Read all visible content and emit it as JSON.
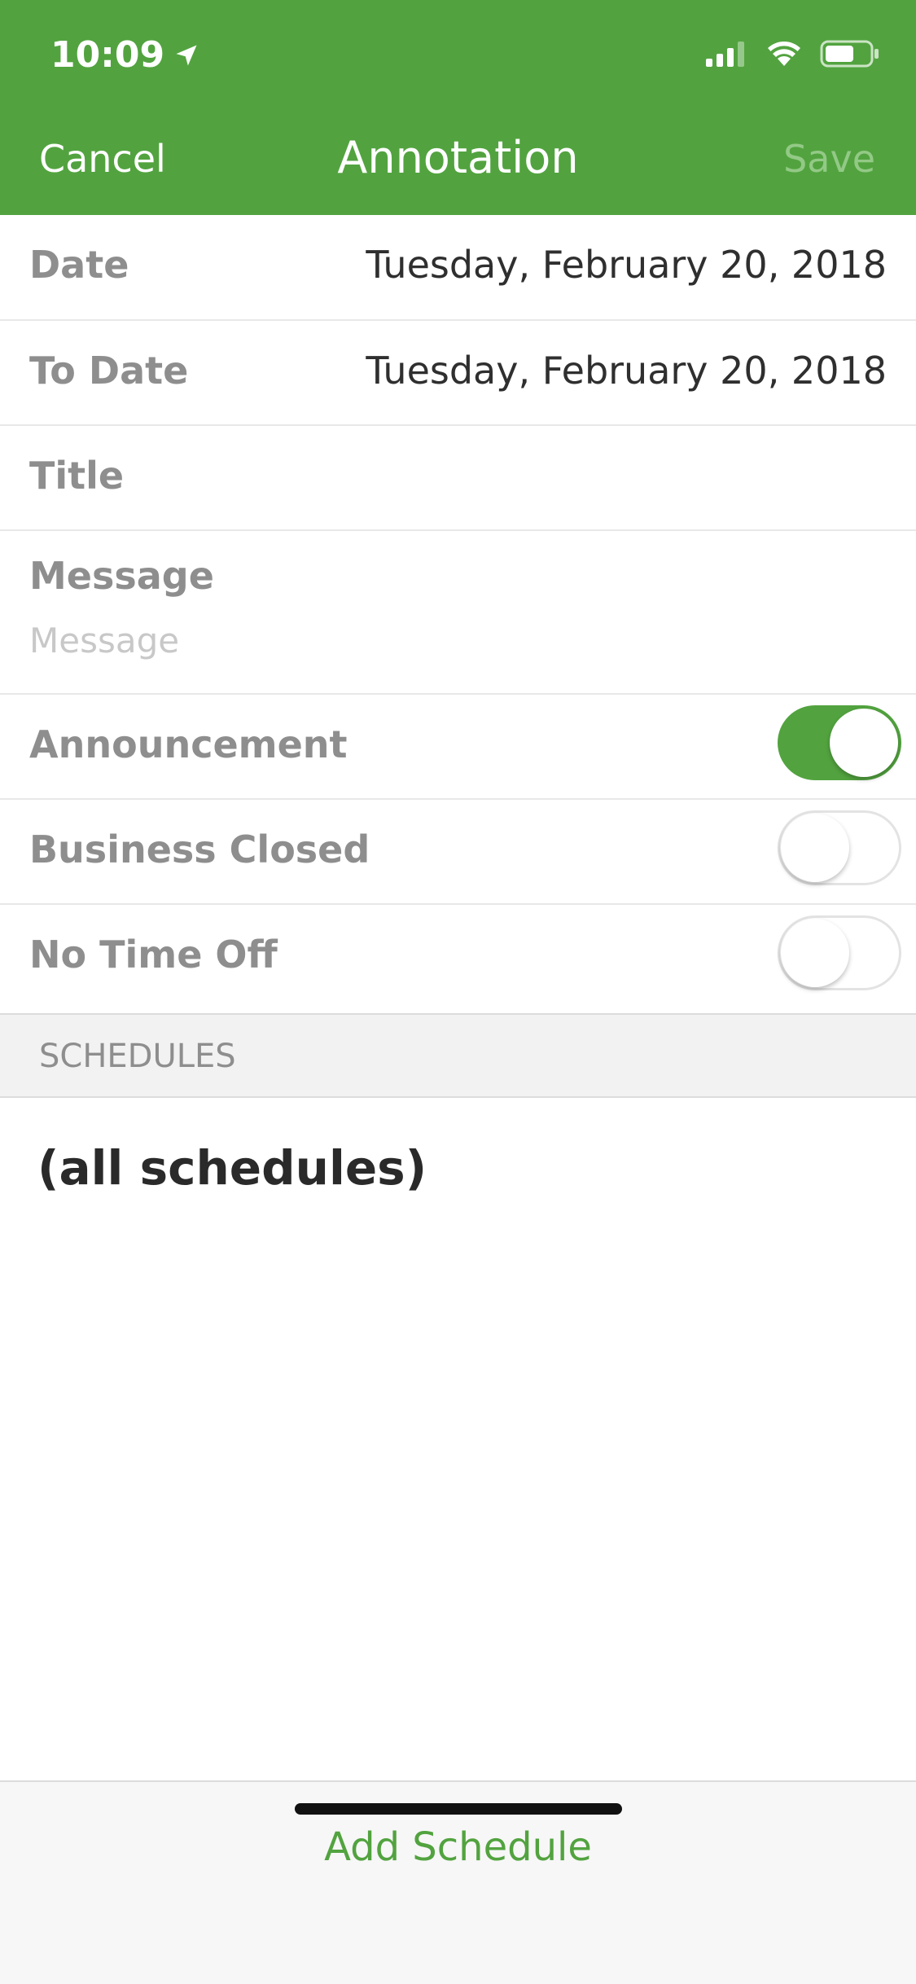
{
  "status_bar": {
    "time": "10:09",
    "icons": [
      "location-arrow-icon",
      "cellular-signal-icon",
      "wifi-icon",
      "battery-icon"
    ]
  },
  "nav": {
    "cancel_label": "Cancel",
    "title": "Annotation",
    "save_label": "Save"
  },
  "form": {
    "date": {
      "label": "Date",
      "value": "Tuesday, February 20, 2018"
    },
    "to_date": {
      "label": "To Date",
      "value": "Tuesday, February 20, 2018"
    },
    "title": {
      "label": "Title",
      "value": ""
    },
    "message": {
      "label": "Message",
      "placeholder": "Message",
      "value": ""
    },
    "announcement": {
      "label": "Announcement",
      "on": true
    },
    "business_closed": {
      "label": "Business Closed",
      "on": false
    },
    "no_time_off": {
      "label": "No Time Off",
      "on": false
    }
  },
  "schedules": {
    "section_label": "SCHEDULES",
    "items": [
      "(all schedules)"
    ]
  },
  "bottom": {
    "add_schedule_label": "Add Schedule"
  },
  "colors": {
    "brand_green": "#52a33f",
    "save_disabled": "#93c986",
    "label_gray": "#8e8e8e"
  }
}
